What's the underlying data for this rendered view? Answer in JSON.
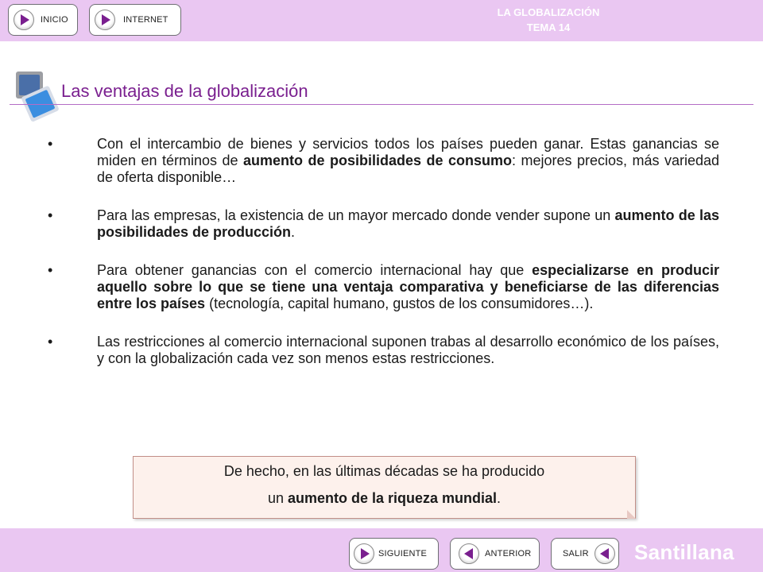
{
  "header": {
    "nav": [
      {
        "label": "INICIO",
        "icon": "play-right-icon"
      },
      {
        "label": "INTERNET",
        "icon": "play-right-icon"
      }
    ],
    "title_line1": "LA GLOBALIZACIÓN",
    "title_line2": "TEMA 14"
  },
  "slide": {
    "title": "Las ventajas de la globalización",
    "bullets": [
      {
        "marker": "•",
        "parts": [
          "Con el intercambio de bienes y servicios todos los países pueden ganar. Estas ganancias se miden en términos de ",
          "aumento de posibilidades de consumo",
          ": mejores precios, más variedad de oferta disponible…"
        ]
      },
      {
        "marker": "•",
        "parts": [
          "Para las empresas, la existencia de un mayor mercado donde vender supone un ",
          "aumento de las posibilidades de producción",
          "."
        ]
      },
      {
        "marker": "•",
        "parts": [
          "Para obtener ganancias con el comercio internacional hay que ",
          "especializarse en producir aquello sobre lo que se tiene una ventaja comparativa y beneficiarse de las diferencias entre los países",
          " (tecnología, capital humano, gustos de los consumidores…)."
        ]
      },
      {
        "marker": "•",
        "parts": [
          "Las restricciones al comercio internacional suponen trabas al desarrollo económico de los países, y con la globalización cada vez son menos estas restricciones.",
          "",
          ""
        ]
      }
    ],
    "note": {
      "line1": "De hecho, en las últimas décadas se ha producido",
      "line2_pre": "un ",
      "line2_bold": "aumento de la riqueza mundial",
      "line2_post": "."
    }
  },
  "footer": {
    "nav": [
      {
        "label": "SIGUIENTE",
        "icon": "play-right-icon"
      },
      {
        "label": "ANTERIOR",
        "icon": "play-left-icon"
      },
      {
        "label": "SALIR",
        "icon": "play-left-icon"
      }
    ],
    "brand": "Santillana"
  },
  "colors": {
    "bar": "#eac7f2",
    "accent": "#7a1f8f",
    "title": "#7a1f8f",
    "note_bg": "#fdf1ec"
  }
}
